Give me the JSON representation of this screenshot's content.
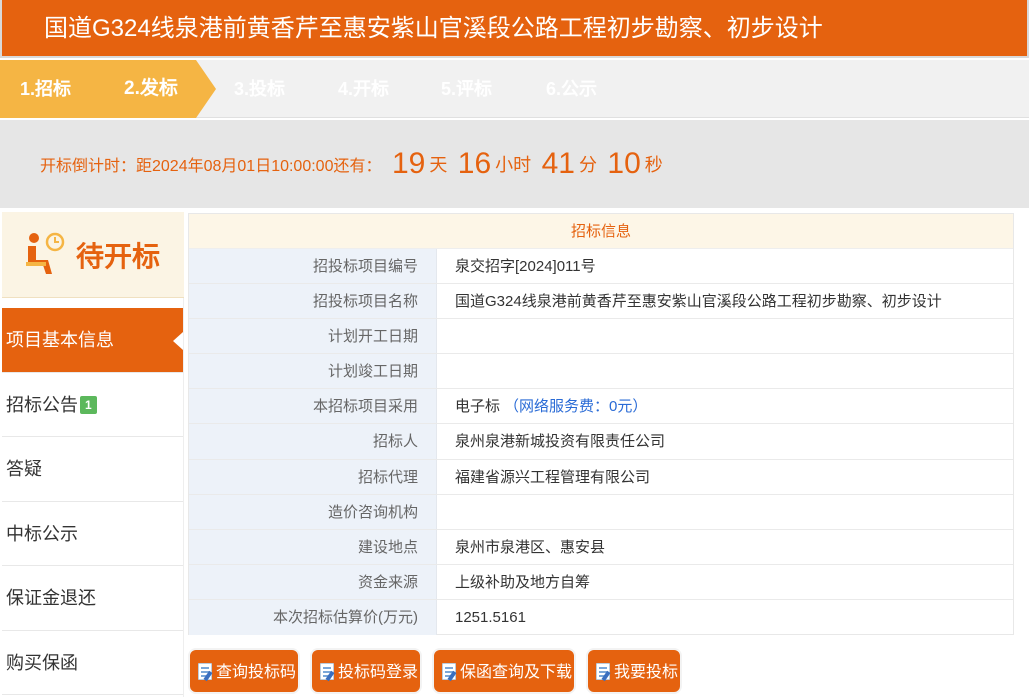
{
  "title": "国道G324线泉港前黄香芹至惠安紫山官溪段公路工程初步勘察、初步设计",
  "steps": [
    "1.招标",
    "2.发标",
    "3.投标",
    "4.开标",
    "5.评标",
    "6.公示"
  ],
  "countdown": {
    "prefix": "开标倒计时：距2024年08月01日10:00:00还有：",
    "days": "19",
    "days_unit": "天",
    "hours": "16",
    "hours_unit": "小时",
    "minutes": "41",
    "minutes_unit": "分",
    "seconds": "10",
    "seconds_unit": "秒"
  },
  "status": "待开标",
  "sidebar": {
    "items": [
      {
        "label": "项目基本信息"
      },
      {
        "label": "招标公告",
        "badge": "1"
      },
      {
        "label": "答疑"
      },
      {
        "label": "中标公示"
      },
      {
        "label": "保证金退还"
      },
      {
        "label": "购买保函"
      }
    ]
  },
  "info": {
    "heading": "招标信息",
    "rows": [
      {
        "label": "招投标项目编号",
        "value": "泉交招字[2024]011号"
      },
      {
        "label": "招投标项目名称",
        "value": "国道G324线泉港前黄香芹至惠安紫山官溪段公路工程初步勘察、初步设计"
      },
      {
        "label": "计划开工日期",
        "value": ""
      },
      {
        "label": "计划竣工日期",
        "value": ""
      },
      {
        "label": "本招标项目采用",
        "value": "电子标",
        "note": "（网络服务费：0元）"
      },
      {
        "label": "招标人",
        "value": "泉州泉港新城投资有限责任公司"
      },
      {
        "label": "招标代理",
        "value": "福建省源兴工程管理有限公司"
      },
      {
        "label": "造价咨询机构",
        "value": ""
      },
      {
        "label": "建设地点",
        "value": "泉州市泉港区、惠安县"
      },
      {
        "label": "资金来源",
        "value": "上级补助及地方自筹"
      },
      {
        "label": "本次招标估算价(万元)",
        "value": "1251.5161"
      }
    ]
  },
  "buttons": [
    "查询投标码",
    "投标码登录",
    "保函查询及下载",
    "我要投标"
  ],
  "colors": {
    "accent": "#e5620f",
    "step_active": "#f5b544"
  }
}
